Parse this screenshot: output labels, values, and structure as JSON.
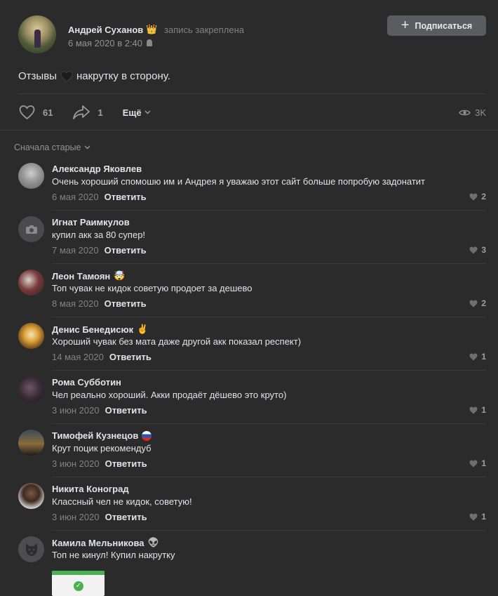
{
  "post": {
    "author": "Андрей Суханов",
    "author_emoji": "👑",
    "pinned_label": "запись закреплена",
    "date": "6 мая 2020 в 2:40",
    "subscribe_label": "Подписаться",
    "text_before": "Отзывы",
    "text_after": "накрутку в сторону.",
    "likes": "61",
    "shares": "1",
    "more_label": "Ещё",
    "views": "3K"
  },
  "sort_label": "Сначала старые",
  "comments": [
    {
      "name": "Александр Яковлев",
      "emoji": "",
      "text": "Очень хороший спомошю им и Андрея я уважаю этот сайт больше попробую задонатит",
      "date": "6 мая 2020",
      "reply": "Ответить",
      "likes": "2"
    },
    {
      "name": "Игнат Раимкулов",
      "emoji": "",
      "text": "купил акк за 80 супер!",
      "date": "7 мая 2020",
      "reply": "Ответить",
      "likes": "3"
    },
    {
      "name": "Леон Тамоян",
      "emoji": "🤯",
      "text": "Топ чувак не кидок советую продоет за дешево",
      "date": "8 мая 2020",
      "reply": "Ответить",
      "likes": "2"
    },
    {
      "name": "Денис Бенедисюк",
      "emoji": "✌",
      "text": "Хороший чувак без мата даже другой акк показал респект)",
      "date": "14 мая 2020",
      "reply": "Ответить",
      "likes": "1"
    },
    {
      "name": "Рома Субботин",
      "emoji": "",
      "text": "Чел реально хороший. Акки продаёт дёшево это круто)",
      "date": "3 июн 2020",
      "reply": "Ответить",
      "likes": "1"
    },
    {
      "name": "Тимофей Кузнецов",
      "emoji": "🇷🇺",
      "text": "Крут поцик рекомендуб",
      "date": "3 июн 2020",
      "reply": "Ответить",
      "likes": "1"
    },
    {
      "name": "Никита Коноград",
      "emoji": "",
      "text": "Классный чел не кидок, советую!",
      "date": "3 июн 2020",
      "reply": "Ответить",
      "likes": "1"
    },
    {
      "name": "Камила Мельникова",
      "emoji": "👽",
      "text": "Топ не кинул! Купил накрутку",
      "date": "",
      "reply": "",
      "likes": ""
    }
  ],
  "icons": {
    "like": "heart-icon",
    "share": "share-icon",
    "views": "eye-icon",
    "camera": "camera-icon"
  }
}
